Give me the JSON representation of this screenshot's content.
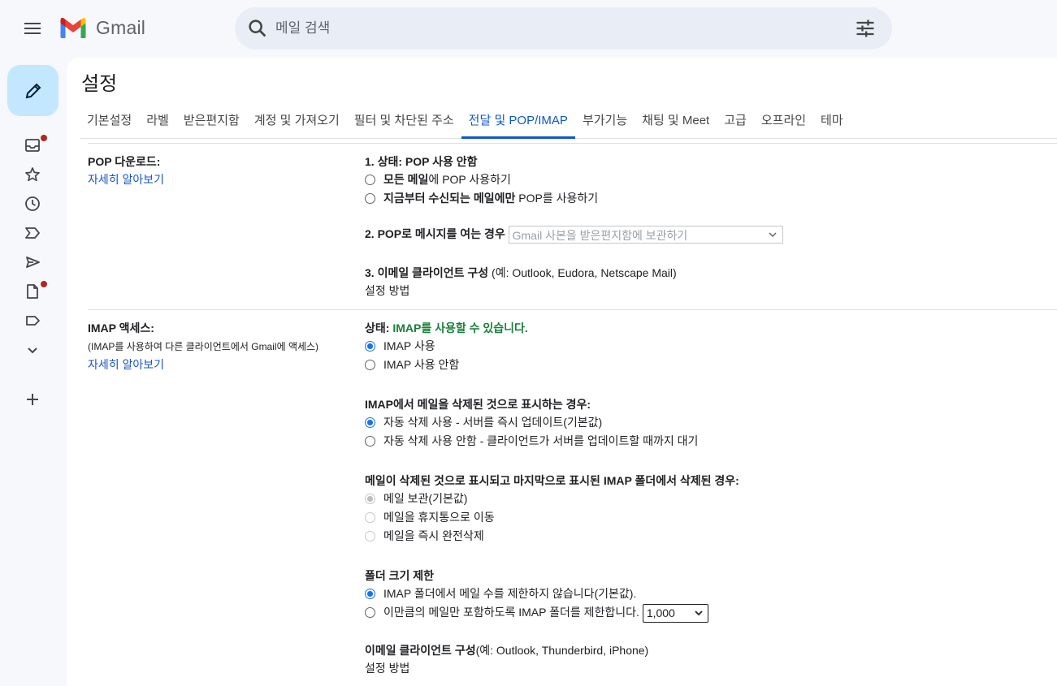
{
  "app": {
    "name": "Gmail"
  },
  "search": {
    "placeholder": "메일 검색"
  },
  "page_title": "설정",
  "tabs": [
    {
      "label": "기본설정"
    },
    {
      "label": "라벨"
    },
    {
      "label": "받은편지함"
    },
    {
      "label": "계정 및 가져오기"
    },
    {
      "label": "필터 및 차단된 주소"
    },
    {
      "label": "전달 및 POP/IMAP",
      "active": true
    },
    {
      "label": "부가기능"
    },
    {
      "label": "채팅 및 Meet"
    },
    {
      "label": "고급"
    },
    {
      "label": "오프라인"
    },
    {
      "label": "테마"
    }
  ],
  "pop": {
    "title": "POP 다운로드:",
    "learn_more": "자세히 알아보기",
    "status_prefix": "1. 상태: POP 사용 안함",
    "option1_bold": "모든 메일",
    "option1_rest": "에 POP 사용하기",
    "option2_bold": "지금부터 수신되는 메일에만",
    "option2_rest": " POP를 사용하기",
    "when_label": "2. POP로 메시지를 여는 경우",
    "when_select": "Gmail 사본을 받은편지함에 보관하기",
    "client_bold": "3. 이메일 클라이언트 구성",
    "client_rest": " (예: Outlook, Eudora, Netscape Mail)",
    "setup_link": "설정 방법"
  },
  "imap": {
    "title": "IMAP 액세스:",
    "subtitle": "(IMAP를 사용하여 다른 클라이언트에서 Gmail에 액세스)",
    "learn_more": "자세히 알아보기",
    "status_label": "상태: ",
    "status_value": "IMAP를 사용할 수 있습니다.",
    "enable": "IMAP 사용",
    "disable": "IMAP 사용 안함",
    "delete_heading": "IMAP에서 메일을 삭제된 것으로 표시하는 경우:",
    "auto_expunge_on": "자동 삭제 사용 - 서버를 즉시 업데이트(기본값)",
    "auto_expunge_off": "자동 삭제 사용 안함 - 클라이언트가 서버를 업데이트할 때까지 대기",
    "expunge_heading": "메일이 삭제된 것으로 표시되고 마지막으로 표시된 IMAP 폴더에서 삭제된 경우:",
    "archive": "메일 보관(기본값)",
    "trash": "메일을 휴지통으로 이동",
    "delete_forever": "메일을 즉시 완전삭제",
    "folder_heading": "폴더 크기 제한",
    "no_limit": "IMAP 폴더에서 메일 수를 제한하지 않습니다(기본값).",
    "limit": "이만큼의 메일만 포함하도록 IMAP 폴더를 제한합니다.",
    "limit_value": "1,000",
    "client_bold": "이메일 클라이언트 구성",
    "client_rest": "(예: Outlook, Thunderbird, iPhone)",
    "setup_link": "설정 방법"
  },
  "colors": {
    "accent": "#0b57d0",
    "compose_bg": "#c2e7ff",
    "badge": "#b3261e",
    "status_green": "#188038"
  },
  "icons": [
    "menu-icon",
    "gmail-logo",
    "search-icon",
    "tune-icon",
    "pencil-icon",
    "inbox-icon",
    "star-icon",
    "clock-icon",
    "important-icon",
    "send-icon",
    "draft-icon",
    "label-icon",
    "chevron-down-icon",
    "plus-icon"
  ]
}
